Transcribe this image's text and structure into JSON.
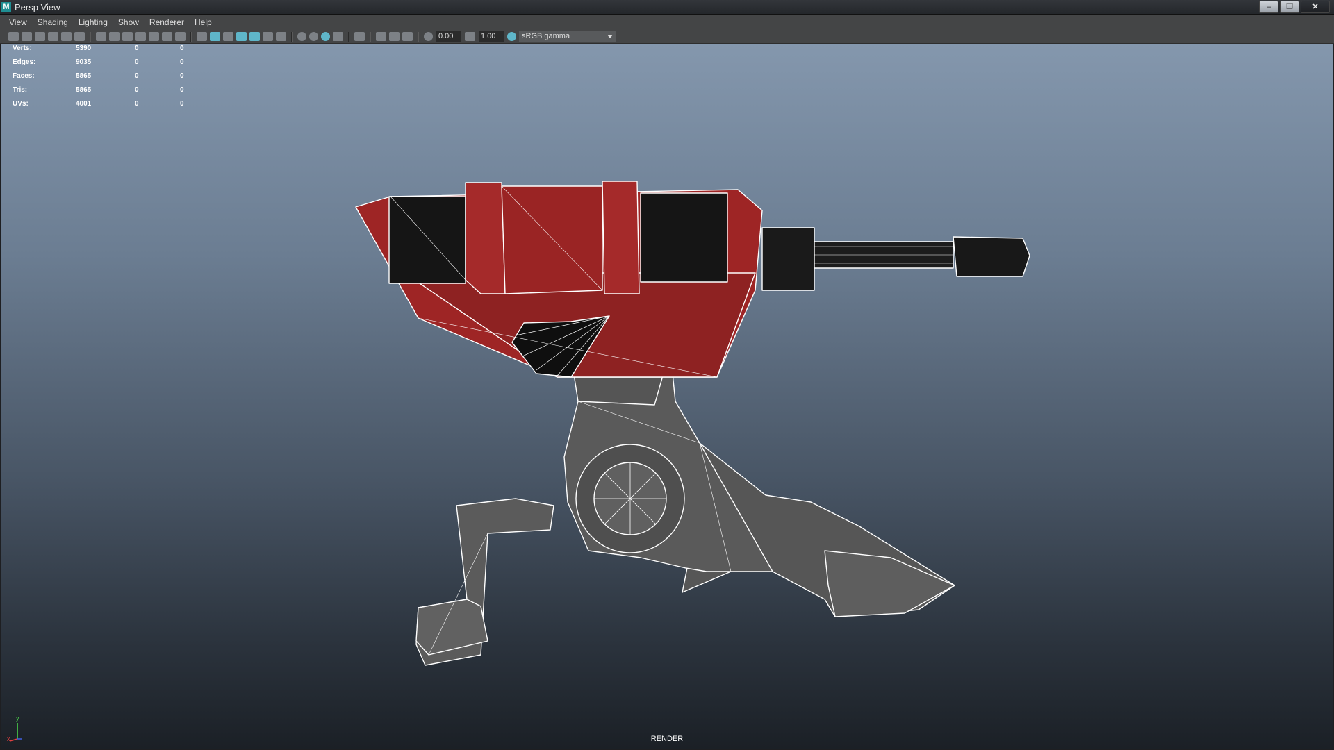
{
  "window": {
    "title": "Persp View",
    "app_logo": "M",
    "controls": [
      "minimize-icon",
      "restore-icon",
      "close-icon"
    ]
  },
  "menu": [
    "View",
    "Shading",
    "Lighting",
    "Show",
    "Renderer",
    "Help"
  ],
  "toolbar": {
    "exposure": "0.00",
    "gamma": "1.00",
    "color_space": "sRGB gamma"
  },
  "hud": {
    "rows": [
      {
        "label": "Verts:",
        "values": [
          "5390",
          "0",
          "0"
        ]
      },
      {
        "label": "Edges:",
        "values": [
          "9035",
          "0",
          "0"
        ]
      },
      {
        "label": "Faces:",
        "values": [
          "5865",
          "0",
          "0"
        ]
      },
      {
        "label": "Tris:",
        "values": [
          "5865",
          "0",
          "0"
        ]
      },
      {
        "label": "UVs:",
        "values": [
          "4001",
          "0",
          "0"
        ]
      }
    ]
  },
  "viewport": {
    "camera_label": "RENDER",
    "axis": {
      "y": "y",
      "x": "x"
    }
  },
  "colors": {
    "accent": "#5fb6c9",
    "model_red": "#9e2525",
    "model_grey": "#5a5a5a",
    "wire": "#ffffff"
  }
}
